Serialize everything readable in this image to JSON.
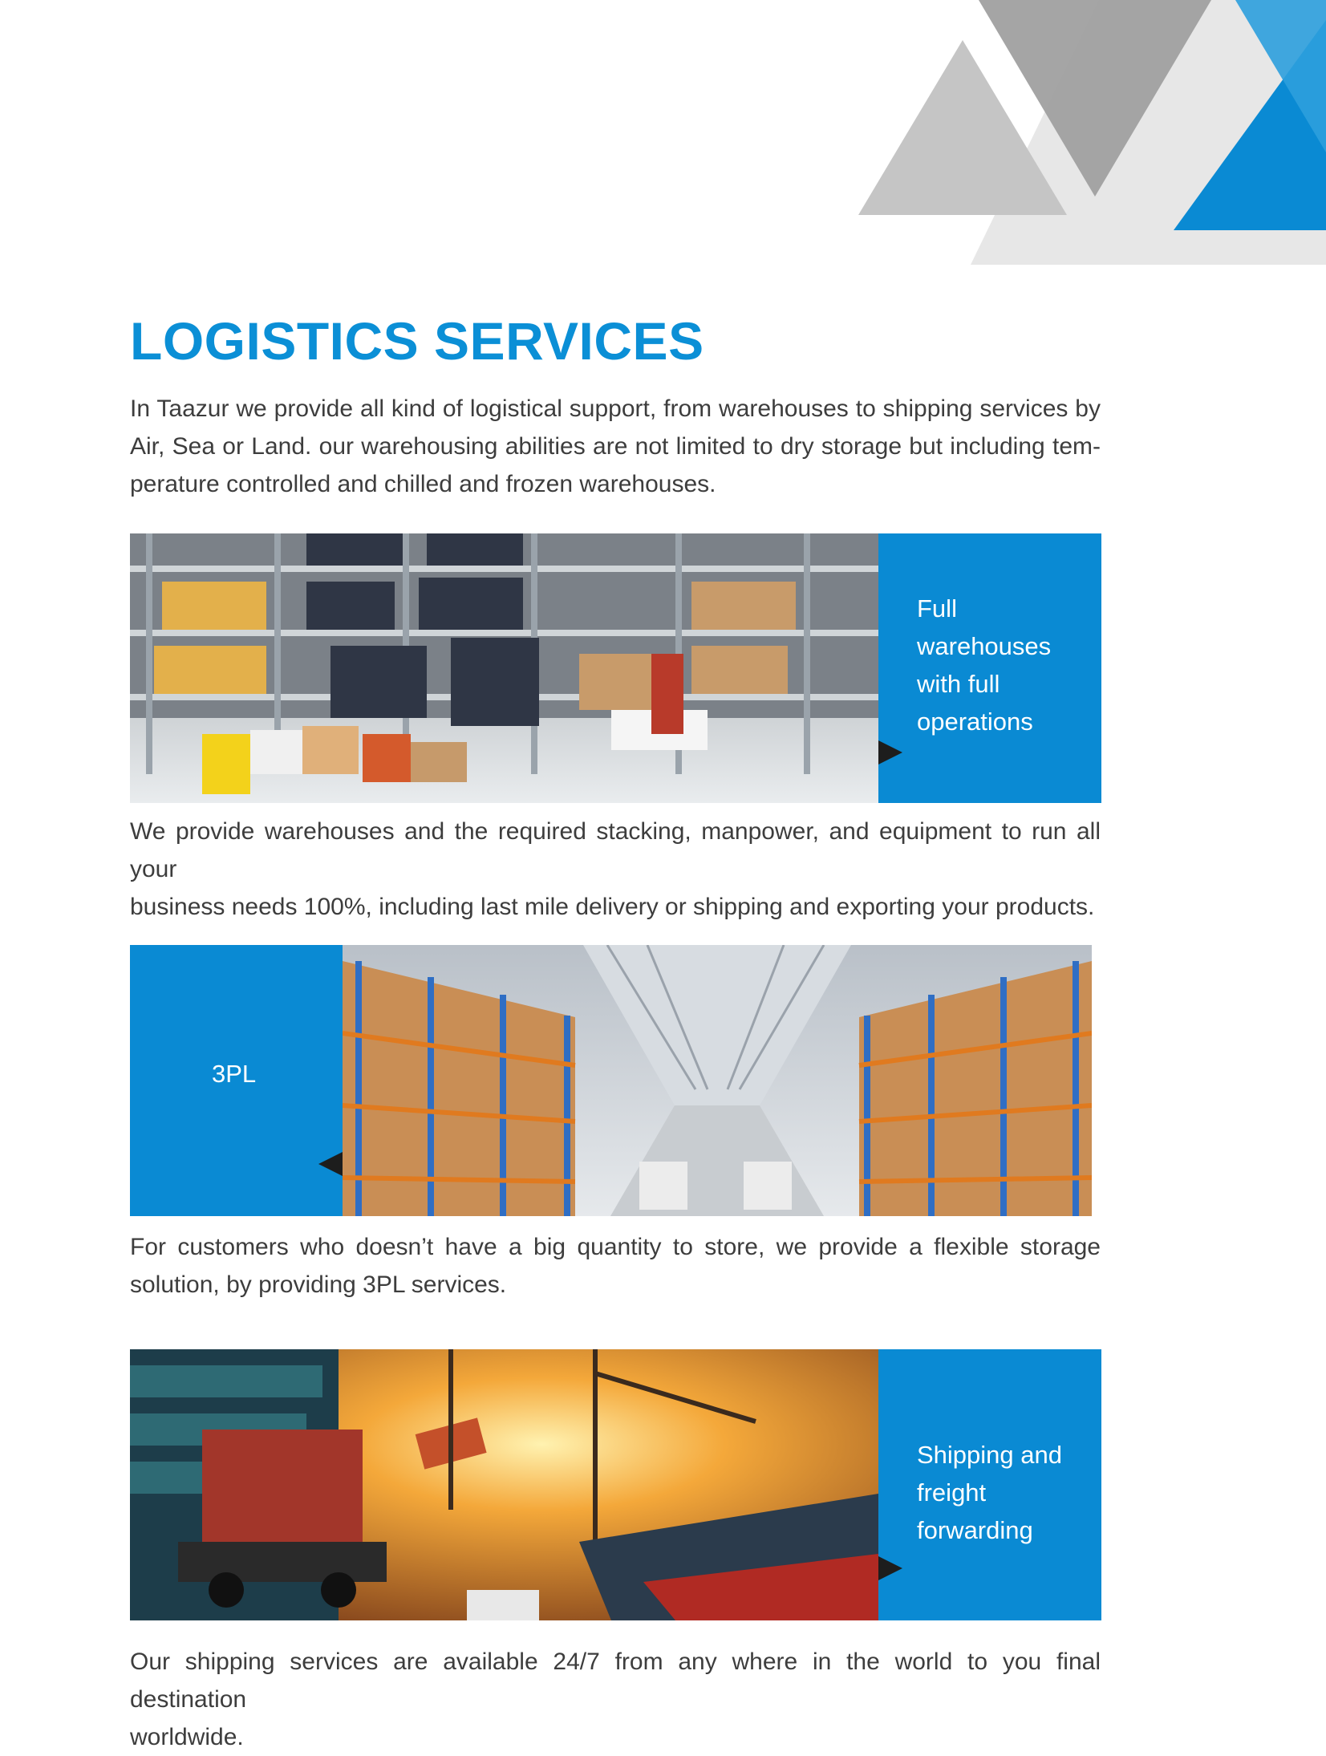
{
  "page": {
    "title": "LOGISTICS SERVICES",
    "intro_lines": [
      "In Taazur we provide all kind of logistical support, from warehouses to shipping services by",
      "Air, Sea or Land. our warehousing abilities are not limited to dry storage but including tem-",
      "perature controlled and chilled and frozen warehouses."
    ]
  },
  "sections": [
    {
      "label_lines": [
        "Full",
        "warehouses",
        "with full",
        "operations"
      ],
      "image": "warehouse-shelves-photo",
      "description_lines": [
        "We provide warehouses and the required stacking, manpower, and equipment to run all your",
        "business needs 100%, including last mile delivery or shipping and exporting your products."
      ]
    },
    {
      "label_lines": [
        "3PL"
      ],
      "image": "warehouse-aisle-photo",
      "description_lines": [
        "For customers who doesn’t have a big quantity to store, we provide a flexible storage",
        "solution, by providing 3PL services."
      ]
    },
    {
      "label_lines": [
        "Shipping and",
        "freight",
        "forwarding"
      ],
      "image": "port-shipping-photo",
      "description_lines": [
        "Our shipping services are available 24/7 from any where in the world to you final destination",
        "worldwide."
      ]
    }
  ],
  "colors": {
    "brand_blue": "#0a8ad3",
    "title_blue": "#0b8fd6",
    "gray_dark": "#9d9d9d",
    "gray_mid": "#c4c4c4",
    "gray_light": "#e6e6e6"
  }
}
